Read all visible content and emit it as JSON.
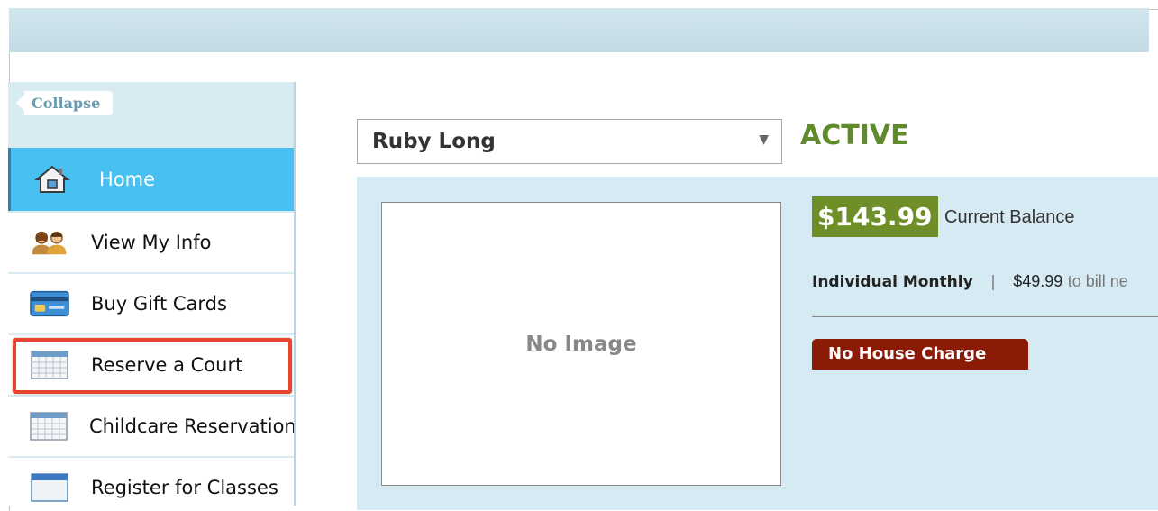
{
  "sidebar": {
    "collapse_label": "Collapse",
    "items": [
      {
        "label": "Home",
        "icon": "home-icon",
        "active": true
      },
      {
        "label": "View My Info",
        "icon": "people-icon"
      },
      {
        "label": "Buy Gift Cards",
        "icon": "gift-card-icon"
      },
      {
        "label": "Reserve a Court",
        "icon": "calendar-icon",
        "highlighted": true
      },
      {
        "label": "Childcare Reservation",
        "icon": "calendar-icon"
      },
      {
        "label": "Register for Classes",
        "icon": "register-icon"
      }
    ]
  },
  "member": {
    "selected_name": "Ruby Long",
    "status": "ACTIVE",
    "photo_placeholder": "No Image",
    "balance": "$143.99",
    "balance_label": "Current Balance",
    "plan": "Individual Monthly",
    "separator": "|",
    "plan_amount": "$49.99",
    "plan_note": "to bill ne",
    "house_charge": "No House Charge"
  },
  "colors": {
    "active_nav": "#48c0f2",
    "status_green": "#5f8b2c",
    "balance_bg": "#6e8f28",
    "house_charge_bg": "#8b1a07",
    "highlight_red": "#e8452f",
    "panel_bg": "#d6eaf3"
  }
}
